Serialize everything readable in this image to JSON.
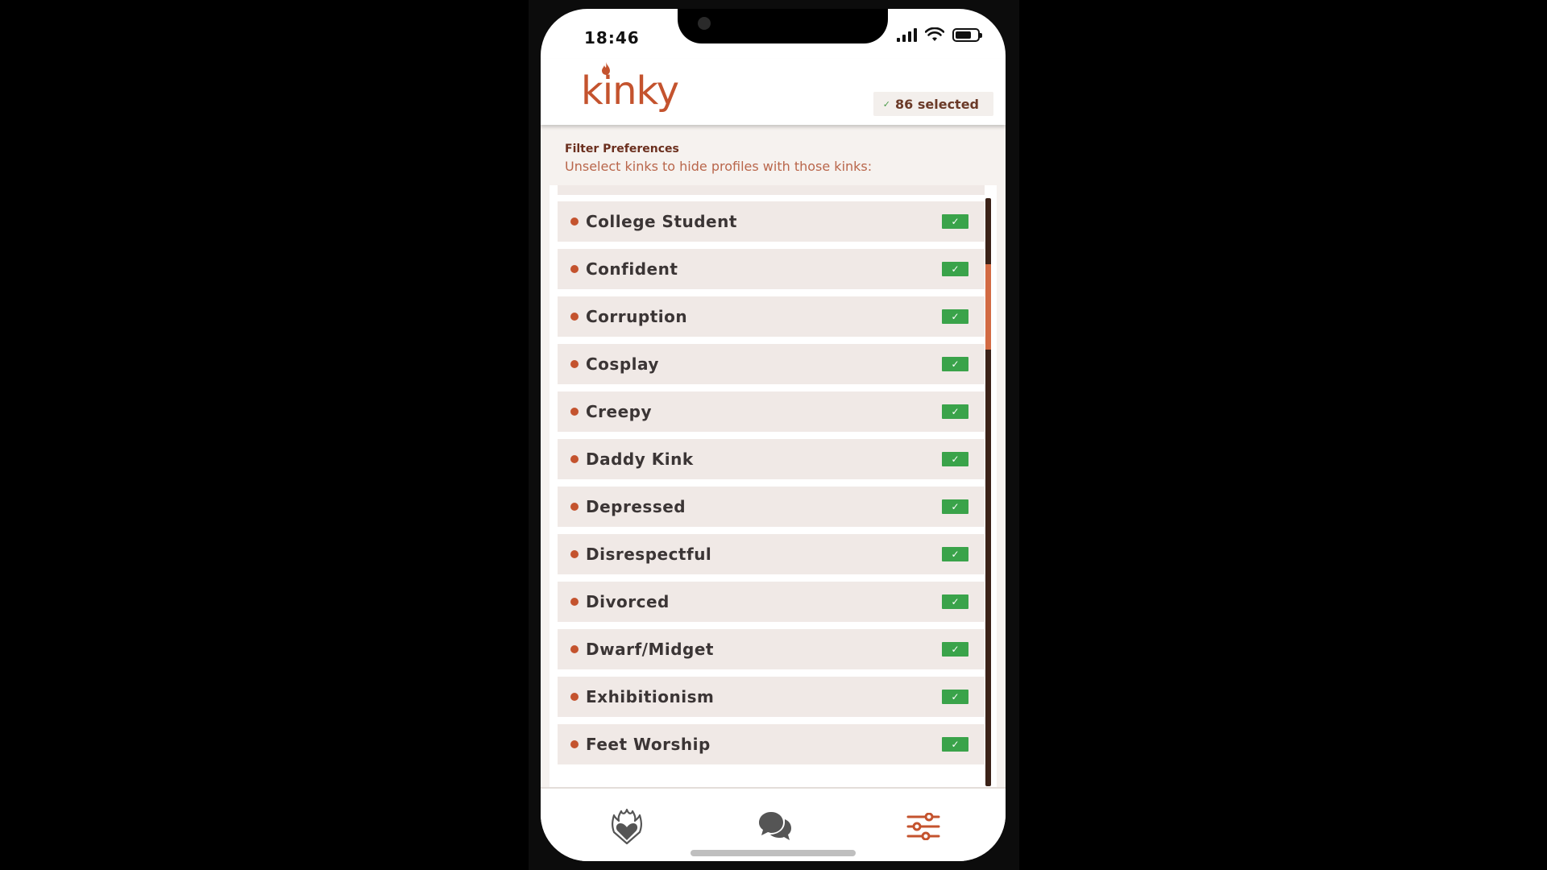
{
  "status_bar": {
    "time": "18:46",
    "battery_level": 0.72
  },
  "header": {
    "logo_text": "kinky",
    "selected_check": "✓",
    "selected_label": "86 selected"
  },
  "filter": {
    "title": "Filter Preferences",
    "subtitle": "Unselect kinks to hide profiles with those kinks:"
  },
  "items": [
    {
      "label": "College Student",
      "check": "✓"
    },
    {
      "label": "Confident",
      "check": "✓"
    },
    {
      "label": "Corruption",
      "check": "✓"
    },
    {
      "label": "Cosplay",
      "check": "✓"
    },
    {
      "label": "Creepy",
      "check": "✓"
    },
    {
      "label": "Daddy Kink",
      "check": "✓"
    },
    {
      "label": "Depressed",
      "check": "✓"
    },
    {
      "label": "Disrespectful",
      "check": "✓"
    },
    {
      "label": "Divorced",
      "check": "✓"
    },
    {
      "label": "Dwarf/Midget",
      "check": "✓"
    },
    {
      "label": "Exhibitionism",
      "check": "✓"
    },
    {
      "label": "Feet Worship",
      "check": "✓"
    }
  ],
  "tabs": [
    {
      "icon": "flame-heart-icon",
      "active": false
    },
    {
      "icon": "chat-bubbles-icon",
      "active": false
    },
    {
      "icon": "sliders-icon",
      "active": true
    }
  ],
  "colors": {
    "brand": "#c4532e",
    "check_green": "#3aa34a",
    "row_bg": "#f0e9e6",
    "inactive_icon": "#555555"
  }
}
